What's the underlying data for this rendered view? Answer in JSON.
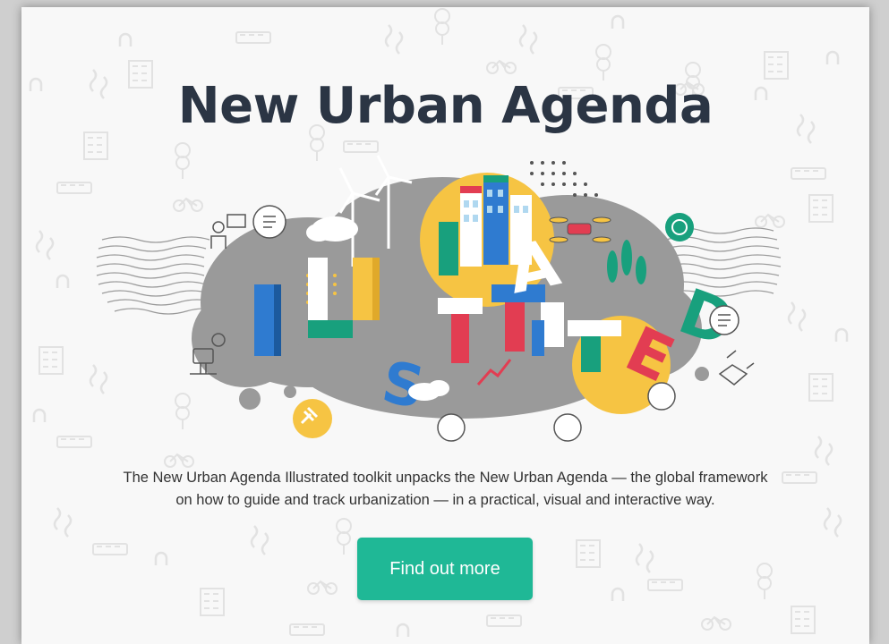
{
  "hero": {
    "title": "New Urban Agenda",
    "description_line1": "The New Urban Agenda Illustrated toolkit unpacks the New Urban Agenda — the global framework",
    "description_line2": "on how to guide and track urbanization — in a practical, visual and interactive way.",
    "cta_label": "Find out more"
  },
  "illustration": {
    "letters": [
      "I",
      "L",
      "L",
      "U",
      "S",
      "T",
      "R",
      "A",
      "T",
      "E",
      "D"
    ]
  },
  "colors": {
    "title": "#2b3544",
    "accent": "#1fb896",
    "illustration_gray": "#9a9a9a",
    "illustration_yellow": "#f6c443",
    "illustration_blue": "#2f7bd0",
    "illustration_red": "#e23d52",
    "illustration_green": "#18a07d"
  },
  "icons": [
    "wind-turbine-icon",
    "bicycle-icon",
    "tree-icon",
    "building-icon",
    "drone-icon",
    "gavel-icon",
    "handshake-icon",
    "masks-icon",
    "checklist-icon",
    "robot-icon",
    "elderly-person-icon",
    "chip-icon"
  ]
}
